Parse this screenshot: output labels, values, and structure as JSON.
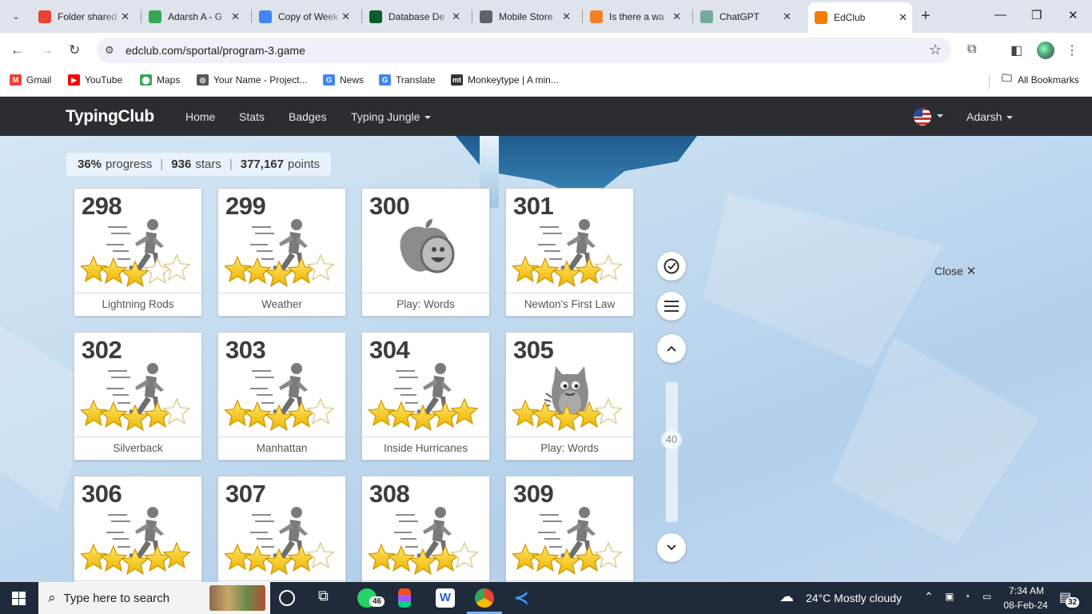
{
  "browser": {
    "tabs": [
      {
        "title": "Folder shared",
        "color": "#ea4335"
      },
      {
        "title": "Adarsh A - G",
        "color": "#34a853"
      },
      {
        "title": "Copy of Week",
        "color": "#4285f4"
      },
      {
        "title": "Database De",
        "color": "#0b5d2a"
      },
      {
        "title": "Mobile Store",
        "color": "#5f6368"
      },
      {
        "title": "Is there a wa",
        "color": "#f48024"
      },
      {
        "title": "ChatGPT",
        "color": "#74aa9c"
      },
      {
        "title": "EdClub",
        "color": "#f57c00"
      }
    ],
    "url": "edclub.com/sportal/program-3.game",
    "bookmarks": [
      {
        "label": "Gmail",
        "color": "#ea4335",
        "glyph": "M"
      },
      {
        "label": "YouTube",
        "color": "#ff0000",
        "glyph": "▶"
      },
      {
        "label": "Maps",
        "color": "#34a853",
        "glyph": "⬤"
      },
      {
        "label": "Your Name - Project...",
        "color": "#555555",
        "glyph": "◎"
      },
      {
        "label": "News",
        "color": "#4285f4",
        "glyph": "G"
      },
      {
        "label": "Translate",
        "color": "#4285f4",
        "glyph": "G"
      },
      {
        "label": "Monkeytype | A min...",
        "color": "#323437",
        "glyph": "mt"
      }
    ],
    "all_bookmarks": "All Bookmarks"
  },
  "site": {
    "brand": "TypingClub",
    "nav": [
      "Home",
      "Stats",
      "Badges",
      "Typing Jungle"
    ],
    "user": "Adarsh",
    "stats": {
      "progress_value": "36%",
      "progress_label": "progress",
      "stars_value": "936",
      "stars_label": "stars",
      "points_value": "377,167",
      "points_label": "points"
    },
    "close_label": "Close",
    "scroll_number": "40"
  },
  "lessons": [
    {
      "num": "298",
      "label": "Lightning Rods",
      "stars": 3,
      "icon": "runner-icon"
    },
    {
      "num": "299",
      "label": "Weather",
      "stars": 4,
      "icon": "runner-icon"
    },
    {
      "num": "300",
      "label": "Play: Words",
      "stars": 0,
      "icon": "apple-game-icon"
    },
    {
      "num": "301",
      "label": "Newton's First Law",
      "stars": 4,
      "icon": "runner-icon"
    },
    {
      "num": "302",
      "label": "Silverback",
      "stars": 4,
      "icon": "runner-icon"
    },
    {
      "num": "303",
      "label": "Manhattan",
      "stars": 4,
      "icon": "runner-icon"
    },
    {
      "num": "304",
      "label": "Inside Hurricanes",
      "stars": 5,
      "icon": "runner-icon"
    },
    {
      "num": "305",
      "label": "Play: Words",
      "stars": 4,
      "icon": "monster-game-icon"
    },
    {
      "num": "306",
      "label": "",
      "stars": 5,
      "icon": "runner-icon"
    },
    {
      "num": "307",
      "label": "",
      "stars": 4,
      "icon": "runner-icon"
    },
    {
      "num": "308",
      "label": "",
      "stars": 4,
      "icon": "runner-icon"
    },
    {
      "num": "309",
      "label": "",
      "stars": 4,
      "icon": "runner-icon"
    }
  ],
  "taskbar": {
    "search_placeholder": "Type here to search",
    "whatsapp_badge": "46",
    "weather": "24°C  Mostly cloudy",
    "time": "7:34 AM",
    "date": "08-Feb-24",
    "notification_count": "32"
  }
}
